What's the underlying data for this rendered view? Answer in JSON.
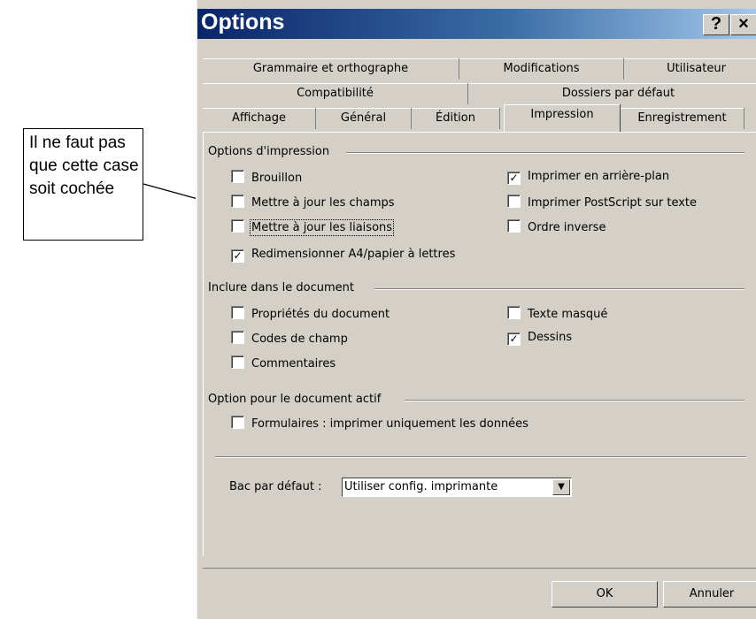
{
  "callout": {
    "text": "Il ne faut pas que cette case soit cochée"
  },
  "dialog": {
    "title": "Options",
    "help_label": "?",
    "close_label": "×",
    "tabs_row1": [
      "Grammaire et orthographe",
      "Modifications",
      "Utilisateur"
    ],
    "tabs_row2": [
      "Compatibilité",
      "Dossiers par défaut"
    ],
    "tabs_row3": [
      "Affichage",
      "Général",
      "Édition",
      "Impression",
      "Enregistrement"
    ],
    "active_tab": "Impression",
    "group_print": {
      "title": "Options d'impression",
      "left": [
        {
          "label": "Brouillon",
          "checked": false
        },
        {
          "label": "Mettre à jour les champs",
          "checked": false
        },
        {
          "label": "Mettre à jour les liaisons",
          "checked": false
        },
        {
          "label": "Redimensionner A4/papier à lettres",
          "checked": true
        }
      ],
      "right": [
        {
          "label": "Imprimer en arrière-plan",
          "checked": true
        },
        {
          "label": "Imprimer PostScript sur texte",
          "checked": false
        },
        {
          "label": "Ordre inverse",
          "checked": false
        }
      ]
    },
    "group_include": {
      "title": "Inclure dans le document",
      "left": [
        {
          "label": "Propriétés du document",
          "checked": false
        },
        {
          "label": "Codes de champ",
          "checked": false
        },
        {
          "label": "Commentaires",
          "checked": false
        }
      ],
      "right": [
        {
          "label": "Texte masqué",
          "checked": false
        },
        {
          "label": "Dessins",
          "checked": true
        }
      ]
    },
    "group_active": {
      "title": "Option pour le document actif",
      "items": [
        {
          "label": "Formulaires : imprimer uniquement les données",
          "checked": false
        }
      ]
    },
    "tray": {
      "label": "Bac par défaut :",
      "value": "Utiliser config. imprimante",
      "dropdown_icon": "▼"
    },
    "buttons": {
      "ok": "OK",
      "cancel": "Annuler"
    }
  }
}
